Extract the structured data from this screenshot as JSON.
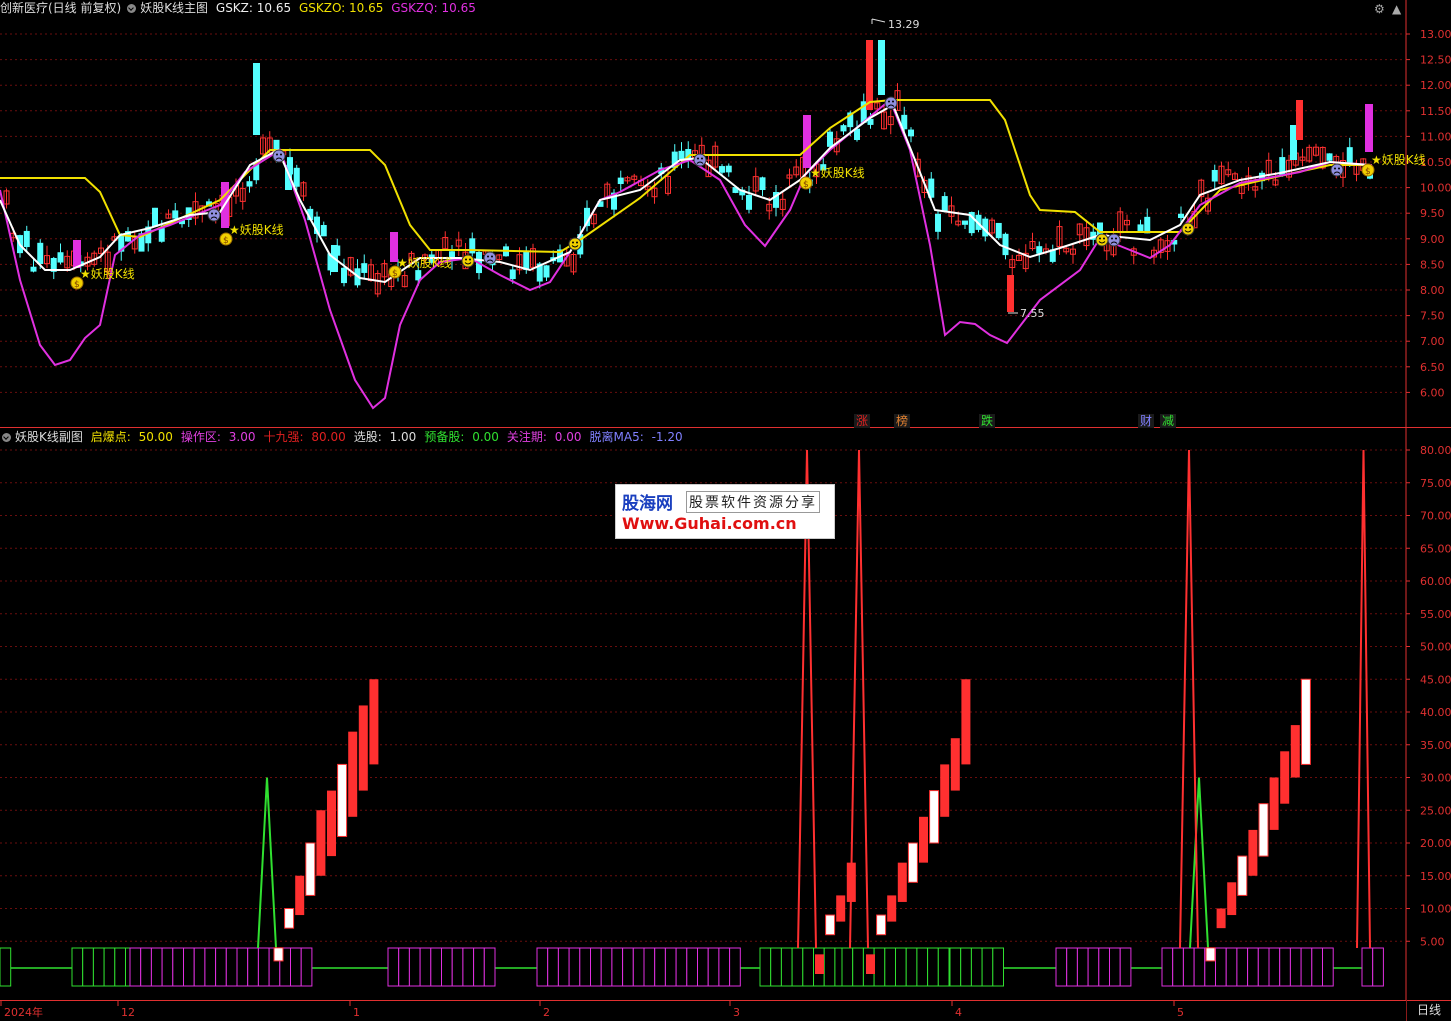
{
  "main_header": {
    "stock": "创新医疗(日线 前复权)",
    "indicator": "妖股K线主图",
    "gskz_label": "GSKZ: 10.65",
    "gskzo_label": "GSKZO: 10.65",
    "gskzq_label": "GSKZQ: 10.65"
  },
  "sub_header": {
    "indicator": "妖股K线副图",
    "params": [
      {
        "label": "启爆点:",
        "value": "50.00",
        "color": "#f0e000"
      },
      {
        "label": "操作区:",
        "value": "3.00",
        "color": "#e040e0"
      },
      {
        "label": "十九强:",
        "value": "80.00",
        "color": "#e02020"
      },
      {
        "label": "选股:",
        "value": "1.00",
        "color": "#dddddd"
      },
      {
        "label": "预备股:",
        "value": "0.00",
        "color": "#30e030"
      },
      {
        "label": "关注期:",
        "value": "0.00",
        "color": "#e040e0"
      },
      {
        "label": "脱离MA5:",
        "value": "-1.20",
        "color": "#8080ff"
      }
    ]
  },
  "colors": {
    "up": "#ff3030",
    "down": "#54ffff",
    "magenta": "#e030e0",
    "yellow": "#f0e000",
    "white": "#ffffff",
    "grid": "#6a0e0e",
    "axis": "#e03030",
    "green": "#30e030"
  },
  "main_axis": {
    "ticks": [
      "13.00",
      "12.50",
      "12.00",
      "11.50",
      "11.00",
      "10.50",
      "10.00",
      "9.50",
      "9.00",
      "8.50",
      "8.00",
      "7.50",
      "7.00",
      "6.50",
      "6.00"
    ]
  },
  "sub_axis": {
    "ticks": [
      "80.00",
      "75.00",
      "70.00",
      "65.00",
      "60.00",
      "55.00",
      "50.00",
      "45.00",
      "40.00",
      "35.00",
      "30.00",
      "25.00",
      "20.00",
      "15.00",
      "10.00",
      "5.00"
    ]
  },
  "date_axis": [
    "2024年",
    "12",
    "1",
    "2",
    "3",
    "4",
    "5"
  ],
  "period_label": "日线",
  "annotations": {
    "high_price": "13.29",
    "low_price": "7.55",
    "signal_text": "妖股K线",
    "markers": [
      "涨",
      "榜",
      "跌",
      "财",
      "减"
    ]
  },
  "watermark": {
    "brand": "股海网",
    "slogan": "股票软件资源分享",
    "url": "Www.Guhai.com.cn"
  }
}
